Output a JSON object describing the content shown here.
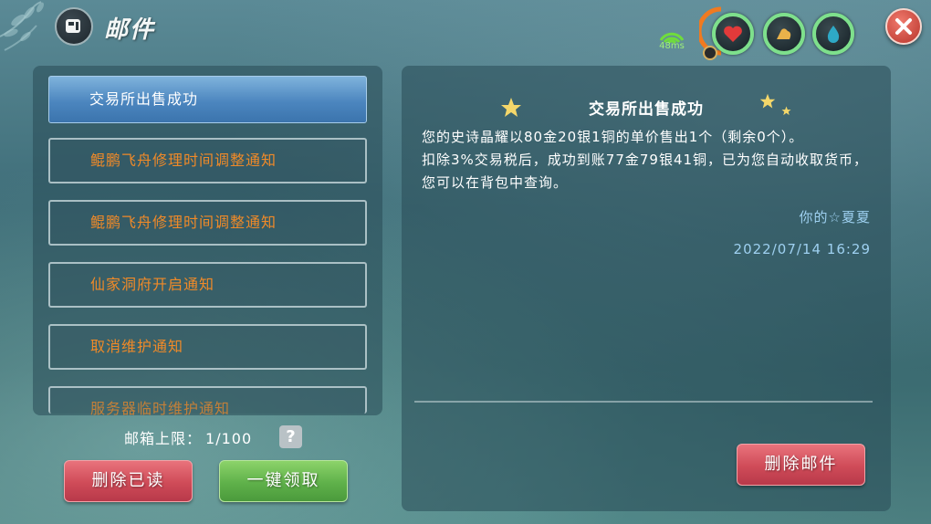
{
  "header": {
    "title": "邮件",
    "ping": "48ms"
  },
  "stats": {
    "hp_icon": "heart-icon",
    "armor_icon": "arm-icon",
    "mana_icon": "droplet-icon"
  },
  "mail_list": {
    "items": [
      {
        "label": "交易所出售成功",
        "selected": true
      },
      {
        "label": "鲲鹏飞舟修理时间调整通知",
        "selected": false
      },
      {
        "label": "鲲鹏飞舟修理时间调整通知",
        "selected": false
      },
      {
        "label": "仙家洞府开启通知",
        "selected": false
      },
      {
        "label": "取消维护通知",
        "selected": false
      },
      {
        "label": "服务器临时维护通知",
        "selected": false
      }
    ],
    "limit_label": "邮箱上限：",
    "limit_value": "1/100",
    "help_label": "?"
  },
  "actions": {
    "delete_read": "删除已读",
    "claim_all": "一键领取",
    "delete_mail": "删除邮件"
  },
  "mail_detail": {
    "title": "交易所出售成功",
    "body_line1": "您的史诗晶耀以80金20银1铜的单价售出1个（剩余0个）。",
    "body_line2": "扣除3%交易税后，成功到账77金79银41铜，已为您自动收取货币，您可以在背包中查询。",
    "sender": "你的☆夏夏",
    "date": "2022/07/14 16:29"
  },
  "colors": {
    "selected_item": "#4c86bf",
    "item_text": "#f08a28",
    "red_button": "#cf4b58",
    "green_button": "#5fb14a",
    "stat_ring": "#7ee08c"
  }
}
